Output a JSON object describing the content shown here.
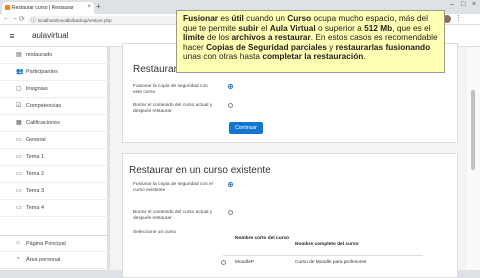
{
  "browser": {
    "tab_title": "Restaurar curso | Restaurar",
    "url": "localhost/moodle/backup/restore.php",
    "new_tab": "+",
    "close": "×",
    "win_min": "–",
    "win_max": "□",
    "win_close": "×",
    "back": "←",
    "forward": "→",
    "reload": "⟳",
    "lock": "ⓘ",
    "menu": "⋮"
  },
  "topnav": {
    "brand": "aulavirtual",
    "menu_icon": "≡"
  },
  "drawer": {
    "items": [
      {
        "icon": "▤",
        "label": "restaurado"
      },
      {
        "icon": "👥",
        "label": "Participantes"
      },
      {
        "icon": "▢",
        "label": "Insignias"
      },
      {
        "icon": "☑",
        "label": "Competencias"
      },
      {
        "icon": "▦",
        "label": "Calificaciones"
      },
      {
        "icon": "▭",
        "label": "General"
      },
      {
        "icon": "▭",
        "label": "Tema 1"
      },
      {
        "icon": "▭",
        "label": "Tema 2"
      },
      {
        "icon": "▭",
        "label": "Tema 3"
      },
      {
        "icon": "▭",
        "label": "Tema 4"
      },
      {
        "icon": "⌂",
        "label": "Página Principal"
      },
      {
        "icon": "◔",
        "label": "Área personal"
      }
    ]
  },
  "card1": {
    "title": "Restaurar en este curso",
    "opt1": "Fusionar la copia de seguridad con este curso",
    "opt2": "Borrar el contenido del curso actual y después restaurar",
    "button": "Continuar"
  },
  "card2": {
    "title": "Restaurar en un curso existente",
    "opt1": "Fusionar la copia de seguridad con el curso existente",
    "opt2": "Borrar el contenido del curso actual y después restaurar",
    "select_label": "Seleccione un curso",
    "col_short": "Nombre corto del curso",
    "col_full": "Nombre completo del curso",
    "row_short": "MoodleP",
    "row_full": "Curso de Moodle para profesores"
  },
  "overlay": {
    "parts": [
      [
        "b",
        "Fusionar"
      ],
      [
        " ",
        " es "
      ],
      [
        "b",
        "útil"
      ],
      [
        " ",
        " cuando un "
      ],
      [
        "b",
        "Curso"
      ],
      [
        " ",
        " ocupa mucho espacio, más del que te permite "
      ],
      [
        "b",
        "subir"
      ],
      [
        " ",
        " el "
      ],
      [
        "b",
        "Aula Virtual"
      ],
      [
        " ",
        " o superior a "
      ],
      [
        "b",
        "512 Mb"
      ],
      [
        " ",
        ", que es el "
      ],
      [
        "b",
        "límite"
      ],
      [
        " ",
        " de los "
      ],
      [
        "b",
        "archivos a restaurar"
      ],
      [
        " ",
        ". En estos casos es recomendable hacer "
      ],
      [
        "b",
        "Copias de Seguridad parciales"
      ],
      [
        " ",
        " y "
      ],
      [
        "b",
        "restaurarlas fusionando"
      ],
      [
        " ",
        " unas con otras hasta "
      ],
      [
        "b",
        "completar la restauración"
      ],
      [
        " ",
        "."
      ]
    ]
  }
}
